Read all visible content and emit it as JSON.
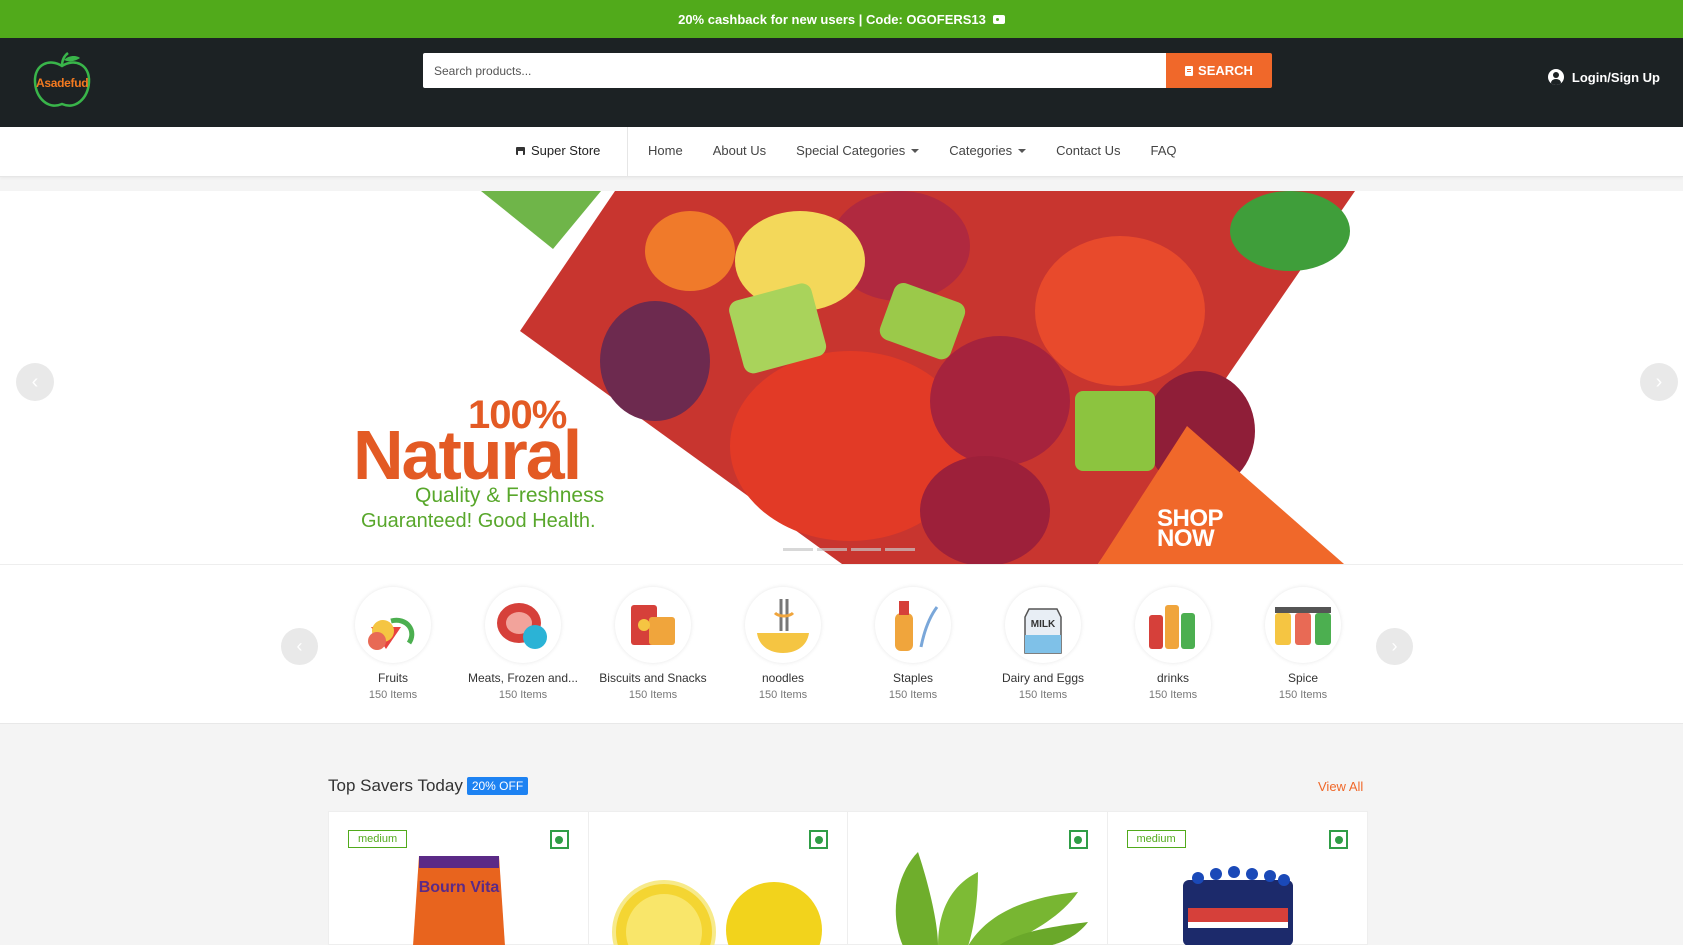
{
  "promo": {
    "text": "20% cashback for new users | Code: OGOFERS13"
  },
  "header": {
    "logo_text": "Asadefud",
    "search_placeholder": "Search products...",
    "search_button": "SEARCH",
    "login": "Login/Sign Up"
  },
  "nav": {
    "store": "Super Store",
    "links": [
      "Home",
      "About Us",
      "Special Categories",
      "Categories",
      "Contact Us",
      "FAQ"
    ]
  },
  "hero": {
    "percent": "100%",
    "headline": "Natural",
    "line1": "Quality & Freshness",
    "line2": "Guaranteed! Good Health.",
    "cta_line1": "SHOP",
    "cta_line2": "NOW",
    "slide_count": 4,
    "active_slide": 1
  },
  "categories": [
    {
      "name": "Fruits",
      "count": "150 Items",
      "icon": "fruits-icon"
    },
    {
      "name": "Meats, Frozen and...",
      "count": "150 Items",
      "icon": "meat-icon"
    },
    {
      "name": "Biscuits and Snacks",
      "count": "150 Items",
      "icon": "snacks-icon"
    },
    {
      "name": "noodles",
      "count": "150 Items",
      "icon": "noodles-icon"
    },
    {
      "name": "Staples",
      "count": "150 Items",
      "icon": "staples-icon"
    },
    {
      "name": "Dairy and Eggs",
      "count": "150 Items",
      "icon": "milk-icon"
    },
    {
      "name": "drinks",
      "count": "150 Items",
      "icon": "drinks-icon"
    },
    {
      "name": "Spice",
      "count": "150 Items",
      "icon": "spice-icon"
    }
  ],
  "milk_label": "MILK",
  "savers": {
    "title": "Top Savers Today",
    "badge": "20% OFF",
    "view_all": "View All",
    "products": [
      {
        "badge": "medium",
        "image": "bournvita-image",
        "brand": "Bourn Vita"
      },
      {
        "badge": "",
        "image": "lemon-image"
      },
      {
        "badge": "",
        "image": "banana-image"
      },
      {
        "badge": "medium",
        "image": "pepsi-bottles-image"
      }
    ]
  },
  "colors": {
    "primary_green": "#51aa1b",
    "accent_orange": "#f0682a",
    "header_dark": "#1c2224",
    "badge_blue": "#1d82f2"
  }
}
